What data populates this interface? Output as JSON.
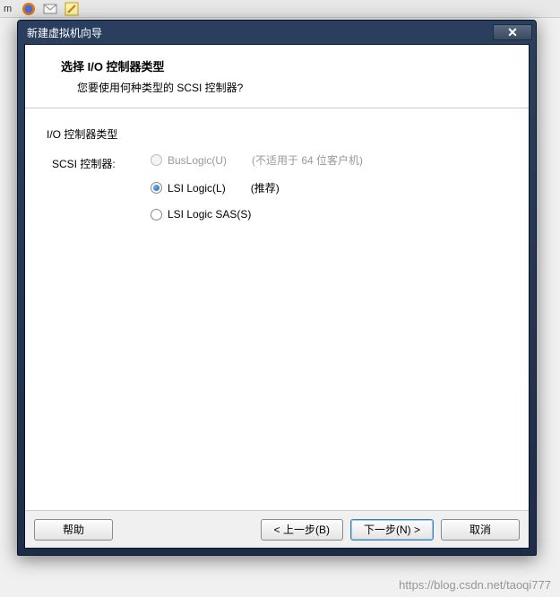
{
  "desktop": {
    "tab_text": "m"
  },
  "dialog": {
    "title": "新建虚拟机向导",
    "header": {
      "title": "选择 I/O 控制器类型",
      "subtitle": "您要使用何种类型的 SCSI 控制器?"
    },
    "section_label": "I/O 控制器类型",
    "controller_label": "SCSI 控制器:",
    "options": [
      {
        "label": "BusLogic(U)",
        "note": "(不适用于 64 位客户机)",
        "disabled": true,
        "selected": false
      },
      {
        "label": "LSI Logic(L)",
        "note": "(推荐)",
        "disabled": false,
        "selected": true
      },
      {
        "label": "LSI Logic SAS(S)",
        "note": "",
        "disabled": false,
        "selected": false
      }
    ],
    "buttons": {
      "help": "帮助",
      "back": "< 上一步(B)",
      "next": "下一步(N) >",
      "cancel": "取消"
    }
  },
  "watermark": "https://blog.csdn.net/taoqi777"
}
